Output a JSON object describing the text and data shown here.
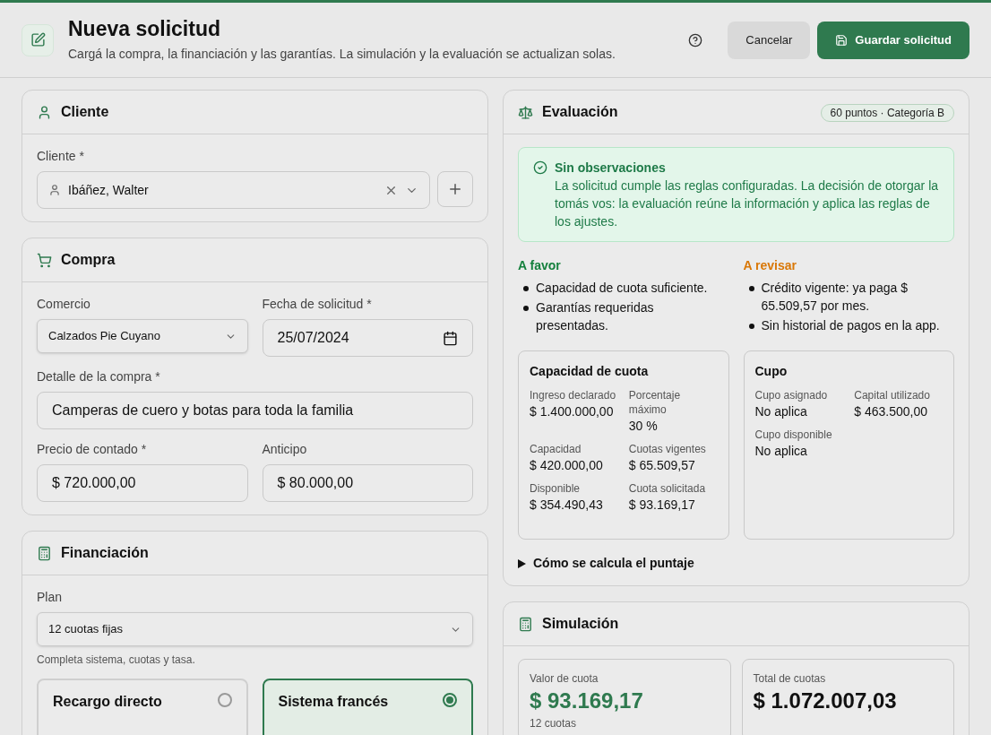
{
  "header": {
    "title": "Nueva solicitud",
    "subtitle": "Cargá la compra, la financiación y las garantías. La simulación y la evaluación se actualizan solas.",
    "buttons": [
      {
        "label": "Cancelar",
        "kind": "secondary"
      },
      {
        "label": "Guardar solicitud",
        "kind": "primary"
      }
    ]
  },
  "cliente": {
    "title": "Cliente",
    "field_label": "Cliente *",
    "value": "Ibáñez, Walter"
  },
  "compra": {
    "title": "Compra",
    "fields": [
      {
        "label": "Comercio",
        "value": "Calzados Pie Cuyano",
        "kind": "select"
      },
      {
        "label": "Fecha de solicitud *",
        "value": "25/07/2024",
        "kind": "date"
      },
      {
        "label": "Detalle de la compra *",
        "value": "Camperas de cuero y botas para toda la familia",
        "kind": "text",
        "wide": true
      },
      {
        "label": "Precio de contado *",
        "value": "$ 720.000,00",
        "kind": "text"
      },
      {
        "label": "Anticipo",
        "value": "$ 80.000,00",
        "kind": "text"
      }
    ]
  },
  "financiacion": {
    "title": "Financiación",
    "plan_label": "Plan",
    "plan_value": "12 cuotas fijas",
    "hint": "Completa sistema, cuotas y tasa.",
    "options": [
      {
        "label": "Recargo directo",
        "selected": false
      },
      {
        "label": "Sistema francés",
        "selected": true
      }
    ]
  },
  "evaluacion": {
    "title": "Evaluación",
    "badge": "60 puntos · Categoría B",
    "alert": {
      "title": "Sin observaciones",
      "text": "La solicitud cumple las reglas configuradas. La decisión de otorgar la tomás vos: la evaluación reúne la información y aplica las reglas de los ajustes."
    },
    "lists": [
      {
        "title": "A favor",
        "color": "#15803d",
        "items": [
          "Capacidad de cuota suficiente.",
          "Garantías requeridas presentadas."
        ]
      },
      {
        "title": "A revisar",
        "color": "#d97706",
        "items": [
          "Crédito vigente: ya paga $ 65.509,57 por mes.",
          "Sin historial de pagos en la app."
        ]
      }
    ],
    "cards": [
      {
        "title": "Capacidad de cuota",
        "stats": [
          {
            "label": "Ingreso declarado",
            "value": "$ 1.400.000,00"
          },
          {
            "label": "Porcentaje máximo",
            "value": "30 %"
          },
          {
            "label": "Capacidad",
            "value": "$ 420.000,00"
          },
          {
            "label": "Cuotas vigentes",
            "value": "$ 65.509,57"
          },
          {
            "label": "Disponible",
            "value": "$ 354.490,43"
          },
          {
            "label": "Cuota solicitada",
            "value": "$ 93.169,17"
          }
        ]
      },
      {
        "title": "Cupo",
        "stats": [
          {
            "label": "Cupo asignado",
            "value": "No aplica"
          },
          {
            "label": "Capital utilizado",
            "value": "$ 463.500,00"
          },
          {
            "label": "Cupo disponible",
            "value": "No aplica"
          }
        ]
      }
    ],
    "details": {
      "label": "Cómo se calcula el puntaje",
      "expanded": false
    }
  },
  "simulacion": {
    "title": "Simulación",
    "cards": [
      {
        "label": "Valor de cuota",
        "value": "$ 93.169,17",
        "note": "12 cuotas",
        "kind": "accent"
      },
      {
        "label": "Total de cuotas",
        "value": "$ 1.072.007,03",
        "kind": "plain"
      }
    ]
  }
}
